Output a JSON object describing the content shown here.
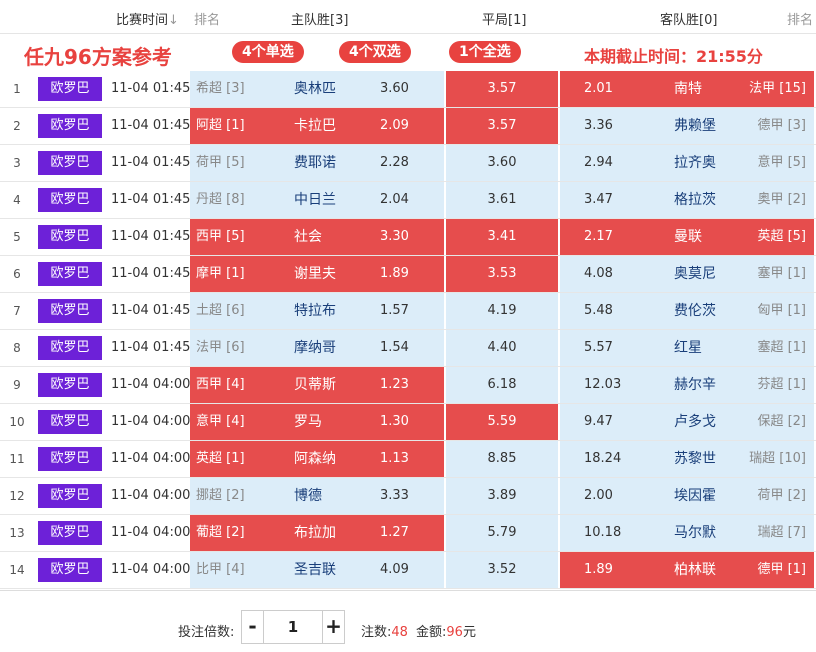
{
  "header": {
    "match_time": "比赛时间",
    "sort_arrow": "↓",
    "rank_left": "排名",
    "home_win": "主队胜[3]",
    "draw": "平局[1]",
    "away_win": "客队胜[0]",
    "rank_right": "排名"
  },
  "banner": {
    "title": "任九96方案参考",
    "single": "4个单选",
    "double": "4个双选",
    "full": "1个全选",
    "deadline": "本期截止时间：21:55分"
  },
  "colors": {
    "selected": "#e64d4d",
    "unselected": "#dcedf9",
    "league_badge": "#6d21d8",
    "accent": "#e8423f"
  },
  "rows": [
    {
      "idx": "1",
      "league": "欧罗巴",
      "time": "11-04 01:45",
      "home_league": "希超 [3]",
      "home": "奥林匹",
      "home_odds": "3.60",
      "draw_odds": "3.57",
      "away_odds": "2.01",
      "away": "南特",
      "away_league": "法甲 [15]",
      "sel_home": false,
      "sel_draw": true,
      "sel_away": true
    },
    {
      "idx": "2",
      "league": "欧罗巴",
      "time": "11-04 01:45",
      "home_league": "阿超 [1]",
      "home": "卡拉巴",
      "home_odds": "2.09",
      "draw_odds": "3.57",
      "away_odds": "3.36",
      "away": "弗赖堡",
      "away_league": "德甲 [3]",
      "sel_home": true,
      "sel_draw": true,
      "sel_away": false
    },
    {
      "idx": "3",
      "league": "欧罗巴",
      "time": "11-04 01:45",
      "home_league": "荷甲 [5]",
      "home": "费耶诺",
      "home_odds": "2.28",
      "draw_odds": "3.60",
      "away_odds": "2.94",
      "away": "拉齐奥",
      "away_league": "意甲 [5]",
      "sel_home": false,
      "sel_draw": false,
      "sel_away": false
    },
    {
      "idx": "4",
      "league": "欧罗巴",
      "time": "11-04 01:45",
      "home_league": "丹超 [8]",
      "home": "中日兰",
      "home_odds": "2.04",
      "draw_odds": "3.61",
      "away_odds": "3.47",
      "away": "格拉茨",
      "away_league": "奥甲 [2]",
      "sel_home": false,
      "sel_draw": false,
      "sel_away": false
    },
    {
      "idx": "5",
      "league": "欧罗巴",
      "time": "11-04 01:45",
      "home_league": "西甲 [5]",
      "home": "社会",
      "home_odds": "3.30",
      "draw_odds": "3.41",
      "away_odds": "2.17",
      "away": "曼联",
      "away_league": "英超 [5]",
      "sel_home": true,
      "sel_draw": true,
      "sel_away": true
    },
    {
      "idx": "6",
      "league": "欧罗巴",
      "time": "11-04 01:45",
      "home_league": "摩甲 [1]",
      "home": "谢里夫",
      "home_odds": "1.89",
      "draw_odds": "3.53",
      "away_odds": "4.08",
      "away": "奥莫尼",
      "away_league": "塞甲 [1]",
      "sel_home": true,
      "sel_draw": true,
      "sel_away": false
    },
    {
      "idx": "7",
      "league": "欧罗巴",
      "time": "11-04 01:45",
      "home_league": "土超 [6]",
      "home": "特拉布",
      "home_odds": "1.57",
      "draw_odds": "4.19",
      "away_odds": "5.48",
      "away": "费伦茨",
      "away_league": "匈甲 [1]",
      "sel_home": false,
      "sel_draw": false,
      "sel_away": false
    },
    {
      "idx": "8",
      "league": "欧罗巴",
      "time": "11-04 01:45",
      "home_league": "法甲 [6]",
      "home": "摩纳哥",
      "home_odds": "1.54",
      "draw_odds": "4.40",
      "away_odds": "5.57",
      "away": "红星",
      "away_league": "塞超 [1]",
      "sel_home": false,
      "sel_draw": false,
      "sel_away": false
    },
    {
      "idx": "9",
      "league": "欧罗巴",
      "time": "11-04 04:00",
      "home_league": "西甲 [4]",
      "home": "贝蒂斯",
      "home_odds": "1.23",
      "draw_odds": "6.18",
      "away_odds": "12.03",
      "away": "赫尔辛",
      "away_league": "芬超 [1]",
      "sel_home": true,
      "sel_draw": false,
      "sel_away": false
    },
    {
      "idx": "10",
      "league": "欧罗巴",
      "time": "11-04 04:00",
      "home_league": "意甲 [4]",
      "home": "罗马",
      "home_odds": "1.30",
      "draw_odds": "5.59",
      "away_odds": "9.47",
      "away": "卢多戈",
      "away_league": "保超 [2]",
      "sel_home": true,
      "sel_draw": true,
      "sel_away": false
    },
    {
      "idx": "11",
      "league": "欧罗巴",
      "time": "11-04 04:00",
      "home_league": "英超 [1]",
      "home": "阿森纳",
      "home_odds": "1.13",
      "draw_odds": "8.85",
      "away_odds": "18.24",
      "away": "苏黎世",
      "away_league": "瑞超 [10]",
      "sel_home": true,
      "sel_draw": false,
      "sel_away": false
    },
    {
      "idx": "12",
      "league": "欧罗巴",
      "time": "11-04 04:00",
      "home_league": "挪超 [2]",
      "home": "博德",
      "home_odds": "3.33",
      "draw_odds": "3.89",
      "away_odds": "2.00",
      "away": "埃因霍",
      "away_league": "荷甲 [2]",
      "sel_home": false,
      "sel_draw": false,
      "sel_away": false
    },
    {
      "idx": "13",
      "league": "欧罗巴",
      "time": "11-04 04:00",
      "home_league": "葡超 [2]",
      "home": "布拉加",
      "home_odds": "1.27",
      "draw_odds": "5.79",
      "away_odds": "10.18",
      "away": "马尔默",
      "away_league": "瑞超 [7]",
      "sel_home": true,
      "sel_draw": false,
      "sel_away": false
    },
    {
      "idx": "14",
      "league": "欧罗巴",
      "time": "11-04 04:00",
      "home_league": "比甲 [4]",
      "home": "圣吉联",
      "home_odds": "4.09",
      "draw_odds": "3.52",
      "away_odds": "1.89",
      "away": "柏林联",
      "away_league": "德甲 [1]",
      "sel_home": false,
      "sel_draw": false,
      "sel_away": true
    }
  ],
  "footer": {
    "multiplier_label": "投注倍数:",
    "minus": "-",
    "plus": "+",
    "multiplier_value": "1",
    "bets_label": "注数:",
    "bets_value": "48",
    "amount_label": "金额:",
    "amount_value": "96",
    "amount_unit": "元"
  }
}
